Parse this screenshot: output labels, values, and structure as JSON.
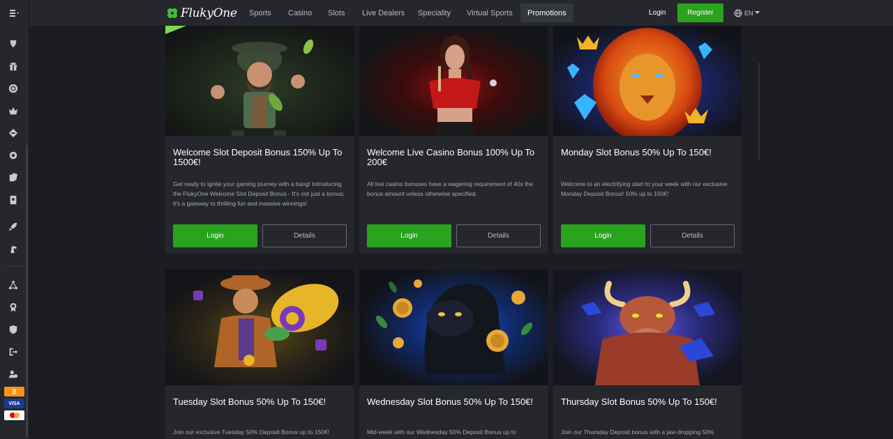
{
  "brand": {
    "name": "FlukyOne"
  },
  "nav": {
    "items": [
      "Sports",
      "Casino",
      "Slots",
      "Live Dealers",
      "Speciality",
      "Virtual Sports",
      "Promotions"
    ],
    "active": "Promotions",
    "login": "Login",
    "register": "Register",
    "language": "EN"
  },
  "colors": {
    "accent": "#2aa31e",
    "background": "#1b1d22",
    "panel": "#25272d"
  },
  "sidebar": {
    "icons": [
      "menu-icon",
      "sports-icon",
      "gift-icon",
      "casino-chip-icon",
      "crown-icon",
      "controller-icon",
      "gear-icon",
      "cards-icon",
      "card-icon",
      "rocket-icon",
      "horse-icon",
      "network-icon",
      "award-icon",
      "shield-icon",
      "logout-icon",
      "user-dollar-icon"
    ],
    "payments": [
      "bitcoin",
      "VISA",
      "mastercard"
    ]
  },
  "promotions": [
    {
      "title": "Welcome Slot Deposit Bonus 150% Up To 1500€!",
      "description": "Get ready to ignite your gaming journey with a bang! Introducing the FlukyOne Welcome Slot Deposit Bonus - It's not just a bonus; it's a gateway to thrilling fun and massive winnings!",
      "login": "Login",
      "details": "Details"
    },
    {
      "title": "Welcome Live Casino Bonus 100% Up To 200€",
      "description": "All live casino bonuses have a wagering requirement of 40x the bonus amount unless otherwise specified.",
      "login": "Login",
      "details": "Details"
    },
    {
      "title": "Monday Slot Bonus 50% Up To 150€!",
      "description": "Welcome to an electrifying start to your week with our exclusive Monday Deposit Bonus! 50% up to 150€!",
      "login": "Login",
      "details": "Details"
    },
    {
      "title": "Tuesday Slot Bonus 50% Up To 150€!",
      "description": "Join our exclusive Tuesday 50% Deposit Bonus up to 150€!"
    },
    {
      "title": "Wednesday Slot Bonus 50% Up To 150€!",
      "description": "Mid-week with our Wednesday 50% Deposit Bonus up to"
    },
    {
      "title": "Thursday Slot Bonus 50% Up To 150€!",
      "description": "Join our Thursday Deposit bonus with a jaw-dropping 50%"
    }
  ]
}
